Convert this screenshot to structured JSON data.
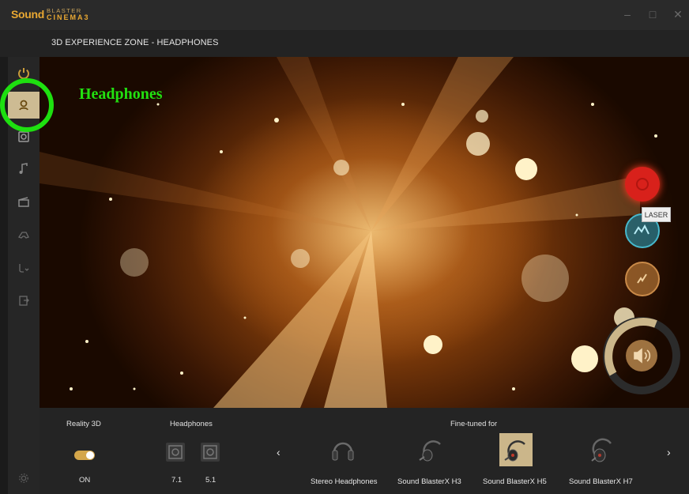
{
  "app": {
    "logo_sound": "Sound",
    "logo_blaster": "BLASTER",
    "logo_cinema": "CINEMA3"
  },
  "window_controls": {
    "minimize": "–",
    "maximize": "□",
    "close": "✕"
  },
  "header": {
    "title": "3D EXPERIENCE ZONE - HEADPHONES"
  },
  "sidebar": {
    "items": [
      {
        "name": "power-icon",
        "active": false
      },
      {
        "name": "headphones-profile-icon",
        "active": true
      },
      {
        "name": "speaker-icon",
        "active": false
      },
      {
        "name": "music-note-icon",
        "active": false
      },
      {
        "name": "clapperboard-icon",
        "active": false
      },
      {
        "name": "gamepad-icon",
        "active": false
      },
      {
        "name": "voice-icon",
        "active": false
      },
      {
        "name": "export-icon",
        "active": false
      },
      {
        "name": "settings-icon",
        "active": false
      }
    ]
  },
  "annotation": {
    "label": "Headphones",
    "color": "#22e010"
  },
  "modes": {
    "items": [
      {
        "name": "red-mode-button",
        "color": "#d8211b"
      },
      {
        "name": "laser-mode-button",
        "color": "#2aa0b4"
      },
      {
        "name": "lightning-mode-button",
        "color": "#b8742e"
      }
    ],
    "tooltip": "LASER"
  },
  "volume": {
    "level": 0.62,
    "accent": "#cbb68a"
  },
  "bottom": {
    "reality3d": {
      "label": "Reality 3D",
      "state": "ON"
    },
    "headphones": {
      "label": "Headphones",
      "options": [
        "7.1",
        "5.1"
      ]
    },
    "finetuned": {
      "label": "Fine-tuned for",
      "prev": "‹",
      "next": "›",
      "devices": [
        {
          "name": "Stereo Headphones",
          "selected": false
        },
        {
          "name": "Sound BlasterX H3",
          "selected": false
        },
        {
          "name": "Sound BlasterX H5",
          "selected": true
        },
        {
          "name": "Sound BlasterX H7",
          "selected": false
        }
      ]
    }
  }
}
